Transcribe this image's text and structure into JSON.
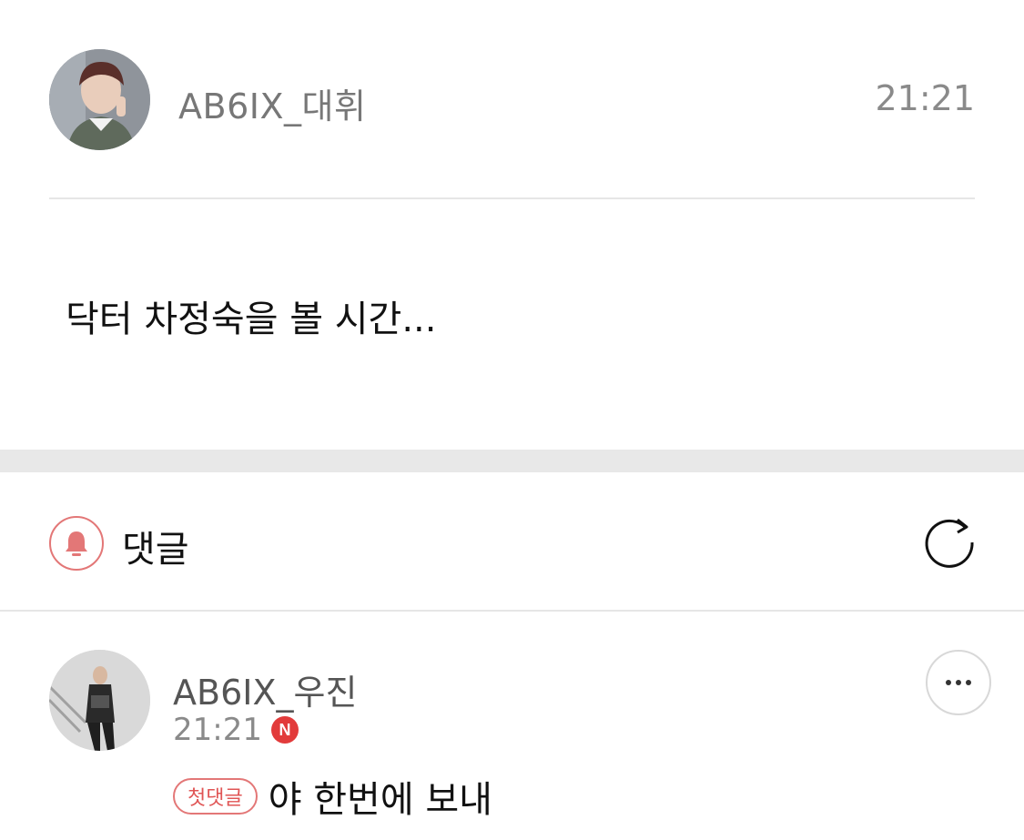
{
  "post": {
    "author": "AB6IX_대휘",
    "time": "21:21",
    "body": "닥터 차정숙을 볼 시간..."
  },
  "comments_section": {
    "title": "댓글",
    "icons": {
      "notify": "bell-icon",
      "refresh": "refresh-icon"
    }
  },
  "comments": [
    {
      "author": "AB6IX_우진",
      "time": "21:21",
      "new_badge": "N",
      "first_comment_badge": "첫댓글",
      "text": "야 한번에 보내",
      "more_icon": "more-dots-icon"
    }
  ],
  "colors": {
    "accent": "#e37777",
    "new_badge": "#e23b3b",
    "section_gap": "#e8e8e8",
    "muted_text": "#8a8a8a"
  }
}
